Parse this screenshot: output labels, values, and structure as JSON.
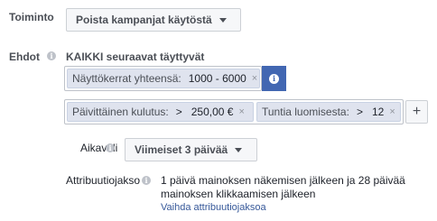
{
  "action": {
    "label": "Toiminto",
    "value": "Poista kampanjat käytöstä"
  },
  "conditions": {
    "label": "Ehdot",
    "mode": "KAIKKI seuraavat täyttyvät",
    "rule1": {
      "key": "Näyttökerrat yhteensä:",
      "value": "1000 - 6000",
      "remove": "×"
    },
    "rule2": {
      "key": "Päivittäinen kulutus:",
      "op": ">",
      "value": "250,00 €",
      "remove": "×"
    },
    "rule3": {
      "key": "Tuntia luomisesta:",
      "op": ">",
      "value": "12",
      "remove": "×"
    },
    "add": "+"
  },
  "time_range": {
    "label": "Aikaväli",
    "value": "Viimeiset 3 päivää"
  },
  "attribution": {
    "label": "Attribuutiojakso",
    "line1": "1 päivä mainoksen näkemisen jälkeen ja 28 päivää",
    "line2": "mainoksen klikkaamisen jälkeen",
    "link": "Vaihda attribuutiojaksoa"
  },
  "icons": {
    "info": "i"
  }
}
